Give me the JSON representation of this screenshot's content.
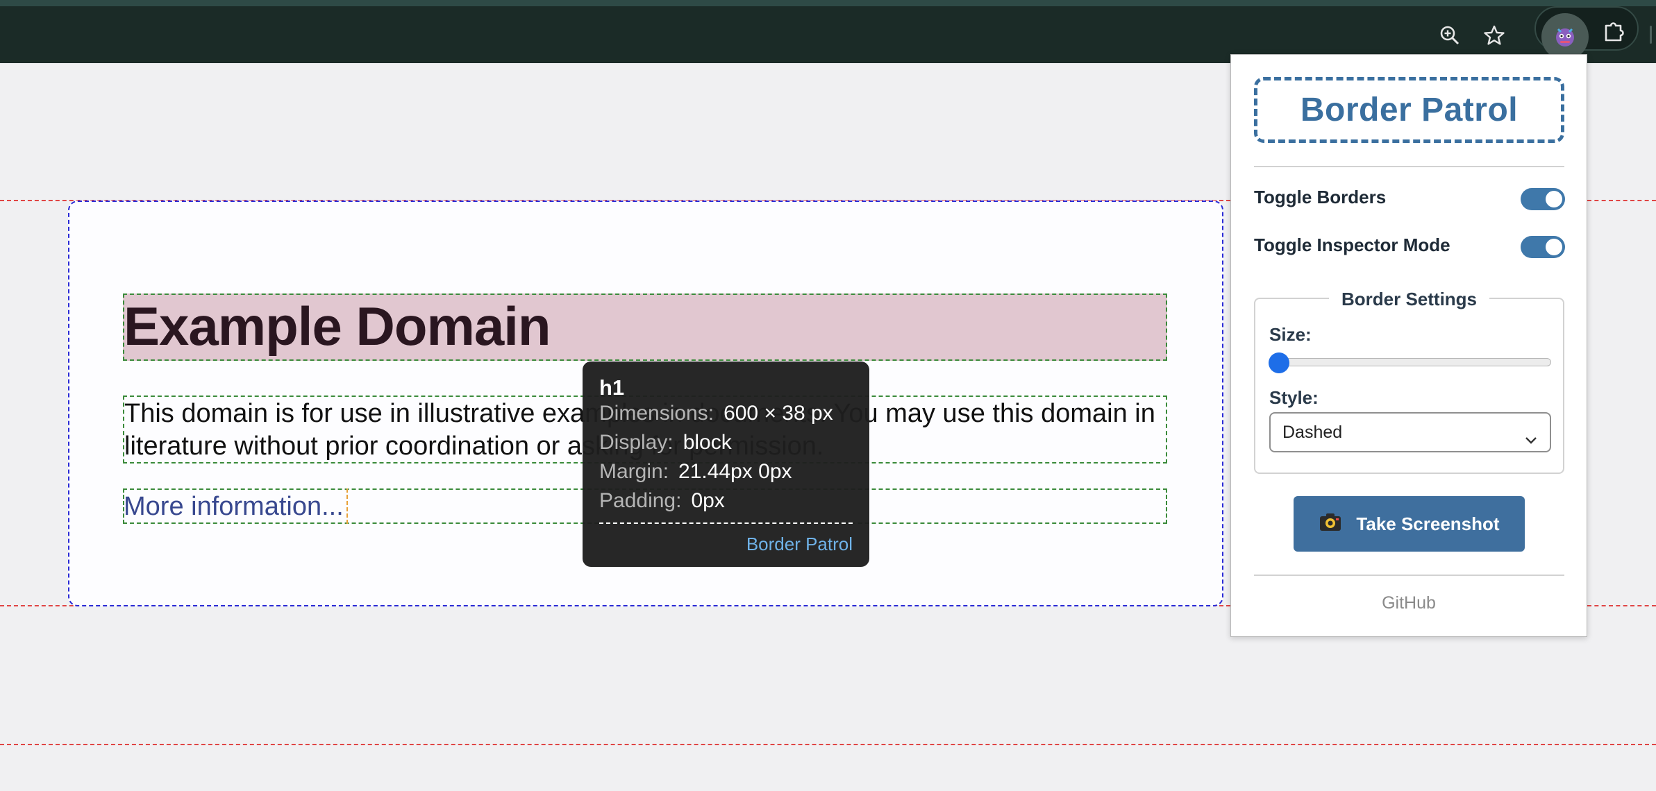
{
  "browser": {
    "zoom_icon": "zoom-in-icon",
    "bookmark_icon": "star-icon",
    "extension_icon": "border-patrol-extension-icon",
    "extensions_icon": "puzzle-icon"
  },
  "page": {
    "heading": "Example Domain",
    "paragraph": "This domain is for use in illustrative examples in documents. You may use this domain in literature without prior coordination or asking for permission.",
    "link": "More information..."
  },
  "tooltip": {
    "tag": "h1",
    "rows": [
      {
        "key": "Dimensions:",
        "value": "600 × 38 px"
      },
      {
        "key": "Display:",
        "value": "block"
      },
      {
        "key": "Margin:",
        "value": "21.44px 0px"
      },
      {
        "key": "Padding:",
        "value": "0px"
      }
    ],
    "brand": "Border Patrol"
  },
  "popup": {
    "title": "Border Patrol",
    "toggle_borders": {
      "label": "Toggle Borders",
      "on": true
    },
    "toggle_inspector": {
      "label": "Toggle Inspector Mode",
      "on": true
    },
    "border_settings": {
      "legend": "Border Settings",
      "size_label": "Size:",
      "size_value": 0,
      "style_label": "Style:",
      "style_value": "Dashed"
    },
    "screenshot_button": "Take Screenshot",
    "screenshot_icon": "camera-icon",
    "footer_link": "GitHub"
  },
  "colors": {
    "accent": "#3f6f9e",
    "toggle_on": "#3f78aa",
    "page_border": "#e04545",
    "container_border": "#2a2ad6",
    "element_border": "#3a8a3a",
    "link": "#38488f",
    "heading_bg": "#e1c7d0"
  }
}
